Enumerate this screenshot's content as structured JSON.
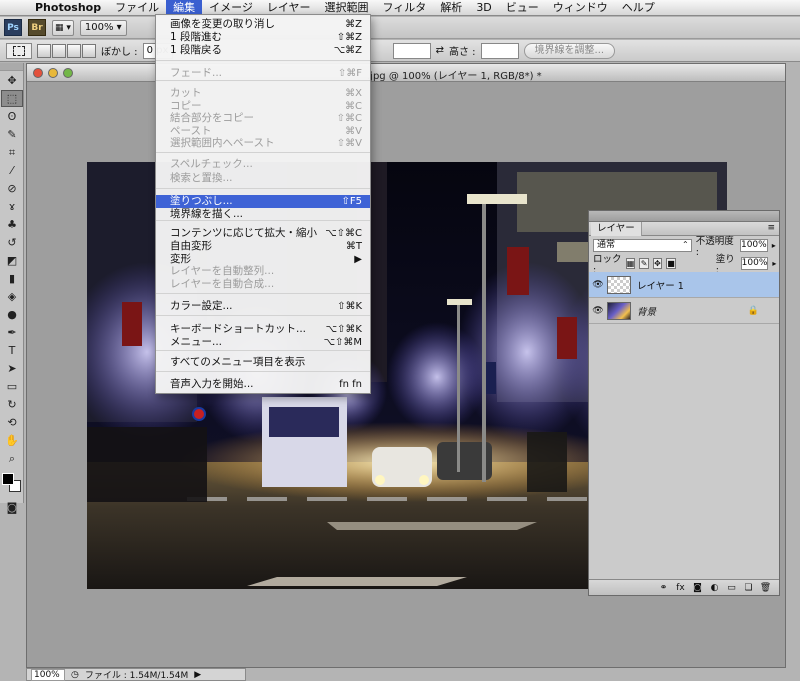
{
  "menubar": {
    "app_name": "Photoshop",
    "items": [
      "ファイル",
      "編集",
      "イメージ",
      "レイヤー",
      "選択範囲",
      "フィルタ",
      "解析",
      "3D",
      "ビュー",
      "ウィンドウ",
      "ヘルプ"
    ],
    "active": "編集"
  },
  "appbar": {
    "ps_label": "Ps",
    "br_label": "Br",
    "zoom": "100%"
  },
  "options": {
    "feather_label": "ぼかし :",
    "feather_value": "0 px",
    "height_label": "高さ :",
    "refine_edge_label": "境界線を調整..."
  },
  "document": {
    "title": ".jpg @ 100% (レイヤー 1, RGB/8*) *"
  },
  "edit_menu": {
    "items": [
      {
        "label": "画像を変更の取り消し",
        "shortcut": "⌘Z",
        "disabled": false
      },
      {
        "label": "1 段階進む",
        "shortcut": "⇧⌘Z",
        "disabled": false
      },
      {
        "label": "1 段階戻る",
        "shortcut": "⌥⌘Z",
        "disabled": false
      },
      {
        "label": "フェード...",
        "shortcut": "⇧⌘F",
        "disabled": true
      },
      {
        "label": "カット",
        "shortcut": "⌘X",
        "disabled": true
      },
      {
        "label": "コピー",
        "shortcut": "⌘C",
        "disabled": true
      },
      {
        "label": "結合部分をコピー",
        "shortcut": "⇧⌘C",
        "disabled": true
      },
      {
        "label": "ペースト",
        "shortcut": "⌘V",
        "disabled": true
      },
      {
        "label": "選択範囲内へペースト",
        "shortcut": "⇧⌘V",
        "disabled": true
      },
      {
        "label": "スペルチェック...",
        "shortcut": "",
        "disabled": true
      },
      {
        "label": "検索と置換...",
        "shortcut": "",
        "disabled": true
      },
      {
        "label": "塗りつぶし...",
        "shortcut": "⇧F5",
        "disabled": false,
        "highlighted": true
      },
      {
        "label": "境界線を描く...",
        "shortcut": "",
        "disabled": false
      },
      {
        "label": "コンテンツに応じて拡大・縮小",
        "shortcut": "⌥⇧⌘C",
        "disabled": false
      },
      {
        "label": "自由変形",
        "shortcut": "⌘T",
        "disabled": false
      },
      {
        "label": "変形",
        "shortcut": "▶",
        "disabled": false
      },
      {
        "label": "レイヤーを自動整列...",
        "shortcut": "",
        "disabled": true
      },
      {
        "label": "レイヤーを自動合成...",
        "shortcut": "",
        "disabled": true
      },
      {
        "label": "カラー設定...",
        "shortcut": "⇧⌘K",
        "disabled": false
      },
      {
        "label": "キーボードショートカット...",
        "shortcut": "⌥⇧⌘K",
        "disabled": false
      },
      {
        "label": "メニュー...",
        "shortcut": "⌥⇧⌘M",
        "disabled": false
      },
      {
        "label": "すべてのメニュー項目を表示",
        "shortcut": "",
        "disabled": false
      },
      {
        "label": "音声入力を開始...",
        "shortcut": "fn fn",
        "disabled": false
      }
    ]
  },
  "layers_panel": {
    "tab": "レイヤー",
    "blend_mode": "通常",
    "opacity_label": "不透明度 :",
    "opacity_value": "100%",
    "lock_label": "ロック :",
    "fill_label": "塗り :",
    "fill_value": "100%",
    "layers": [
      {
        "name": "レイヤー 1",
        "selected": true,
        "locked": false,
        "thumb": "transparent"
      },
      {
        "name": "背景",
        "selected": false,
        "locked": true,
        "thumb": "photo"
      }
    ],
    "footer_icons": [
      "link-icon",
      "fx-icon",
      "mask-icon",
      "adjustment-icon",
      "group-icon",
      "new-layer-icon",
      "trash-icon"
    ]
  },
  "status": {
    "zoom": "100%",
    "file_info": "ファイル : 1.54M/1.54M"
  },
  "colors": {
    "menu_highlight": "#3f63d6",
    "selected_layer": "#a9c5ea",
    "foreground": "#000000",
    "background": "#ffffff"
  }
}
